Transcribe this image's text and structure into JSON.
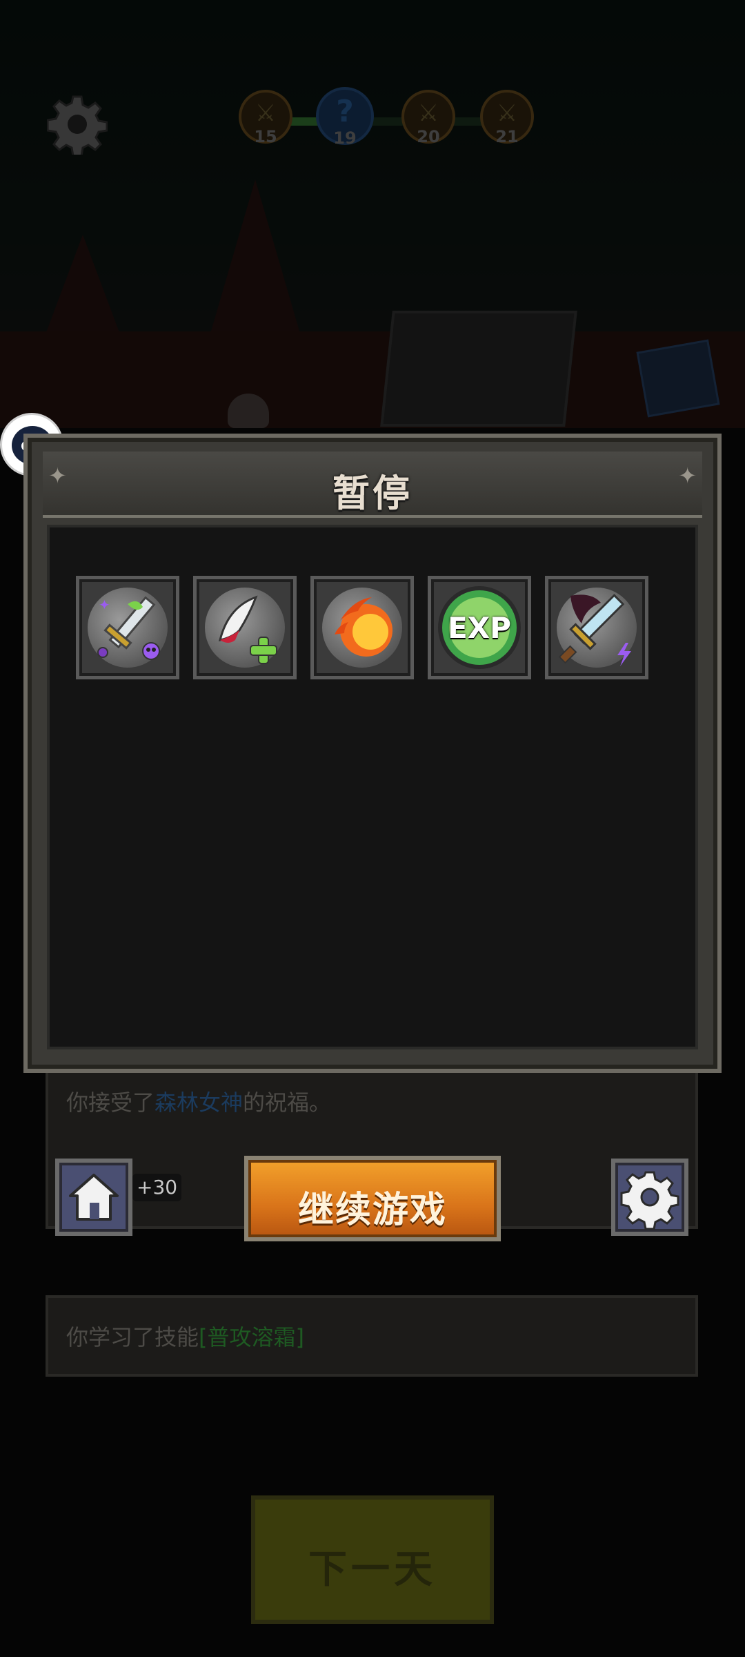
{
  "pause_dialog": {
    "title": "暂停",
    "continue_label": "继续游戏"
  },
  "skills": [
    {
      "name": "poison-sword-icon",
      "color": "#7bd14a"
    },
    {
      "name": "claw-heal-icon",
      "color": "#c8223a"
    },
    {
      "name": "fireball-icon",
      "color": "#f26b1d"
    },
    {
      "name": "exp-boost-icon",
      "label": "EXP",
      "color": "#3fa54a"
    },
    {
      "name": "lightning-sword-icon",
      "color": "#9b5cf0"
    }
  ],
  "stages": [
    {
      "number": "15",
      "state": "cleared"
    },
    {
      "number": "19",
      "state": "current",
      "symbol": "?"
    },
    {
      "number": "20",
      "state": "locked"
    },
    {
      "number": "21",
      "state": "locked"
    }
  ],
  "messages": {
    "blessing_prefix": "你接受了",
    "blessing_name": "森林女神",
    "blessing_suffix": "的祝福。",
    "skill_prefix": "你学习了技能",
    "skill_name": "[普攻溶霜]",
    "badge": "+30"
  },
  "next_day_label": "下一天"
}
